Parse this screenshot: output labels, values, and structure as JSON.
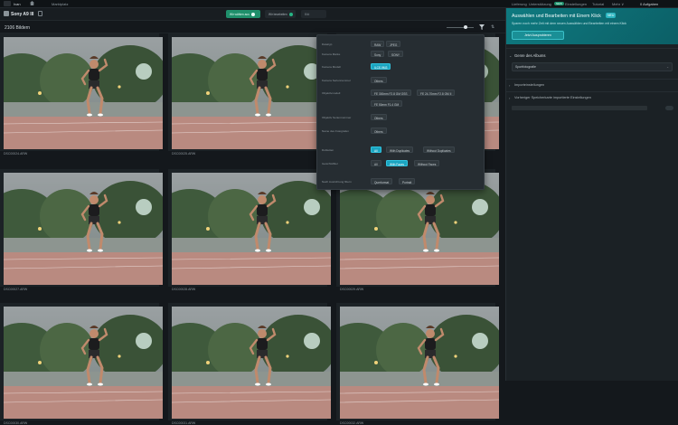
{
  "topbar": {
    "user": "Ivan",
    "nav_left": "Marktplatz",
    "nav_items": [
      "Lieferung",
      "Unterstützung",
      "Einstellungen",
      "Tutorial",
      "Mehr ∨"
    ],
    "badge": "NEW",
    "tasks": "0 Aufgaben"
  },
  "toolbar": {
    "album_title": "Sony A9 III",
    "segments": [
      "Wir wählen aus",
      "Wir bearbeiten",
      "Bild"
    ]
  },
  "subbar": {
    "count": "2106 Bildern"
  },
  "photos": [
    {
      "name": "DSC00024.ARW"
    },
    {
      "name": "DSC00025.ARW"
    },
    {
      "name": "DSC00026.ARW"
    },
    {
      "name": "DSC00027.ARW"
    },
    {
      "name": "DSC00028.ARW"
    },
    {
      "name": "DSC00029.ARW"
    },
    {
      "name": "DSC00030.ARW"
    },
    {
      "name": "DSC00031.ARW"
    },
    {
      "name": "DSC00032.ARW"
    }
  ],
  "filter": {
    "rows": [
      {
        "label": "Dateityp",
        "options": [
          "RAW",
          "JPEG"
        ],
        "active": []
      },
      {
        "label": "Kamera Marke",
        "options": [
          "Sony",
          "SONY"
        ],
        "active": []
      },
      {
        "label": "Kamera Modell",
        "options": [
          "ILCE-9M3"
        ],
        "active": [
          0
        ]
      },
      {
        "label": "Kamera Seriennummer",
        "options": [
          "Others"
        ],
        "active": []
      },
      {
        "label": "Objektivmodell",
        "options": [
          "FE 300mm F2.8 GM OSS",
          "FE 24-70mm F2.8 GM II",
          "FE 50mm F1.4 GM"
        ],
        "active": []
      },
      {
        "label": "Objektiv Seriennummer",
        "options": [
          "Others"
        ],
        "active": []
      },
      {
        "label": "Name des Fotografen",
        "options": [
          "Others"
        ],
        "active": []
      },
      {
        "label": "Dubletten",
        "options": [
          "All",
          "With Duplicates",
          "Without Duplicates"
        ],
        "active": [
          0
        ]
      },
      {
        "label": "Gesichtsfilter",
        "options": [
          "All",
          "With Faces",
          "Without Faces"
        ],
        "active": [
          1
        ]
      },
      {
        "label": "Nach Ausrichtung filtern",
        "options": [
          "Querformat",
          "Portrait"
        ],
        "active": []
      }
    ]
  },
  "panel": {
    "banner_title": "Auswählen und Bearbeiten mit Einem Klick",
    "banner_badge": "NEU",
    "banner_text": "Sparen noch mehr Zeit mit dem neuen Auswählen und Bearbeiten mit einem Klick",
    "banner_button": "Jetzt Ausprobieren",
    "genre_title": "Genre des Albums",
    "genre_value": "Sportfotografie",
    "section2": "Importeinstellungen",
    "section3": "Vorheriger Speicherkarte importierte Einstellungen"
  },
  "colors": {
    "accent_green": "#1f8f6b",
    "accent_cyan": "#1ba4c0",
    "banner": "#0e7a80"
  }
}
